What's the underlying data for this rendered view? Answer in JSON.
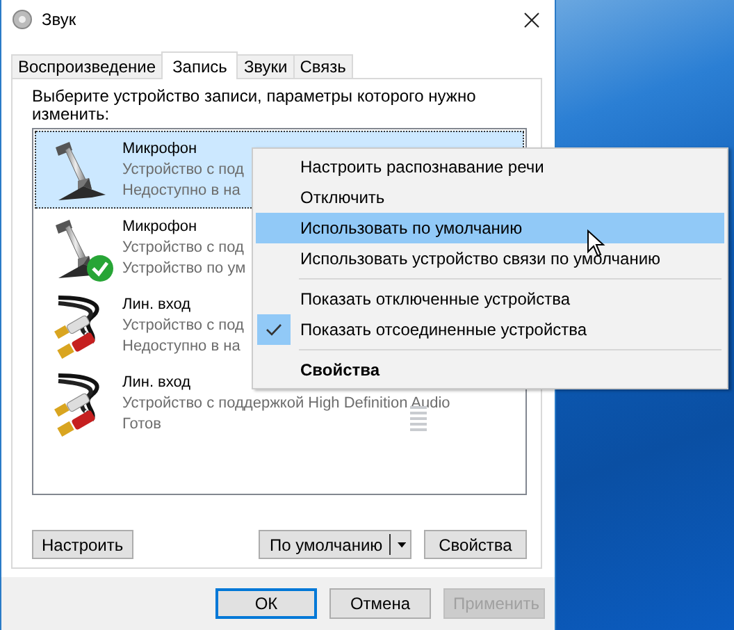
{
  "window": {
    "title": "Звук"
  },
  "tabs": [
    {
      "label": "Воспроизведение",
      "selected": false
    },
    {
      "label": "Запись",
      "selected": true
    },
    {
      "label": "Звуки",
      "selected": false
    },
    {
      "label": "Связь",
      "selected": false
    }
  ],
  "instruction": "Выберите устройство записи, параметры которого нужно изменить:",
  "devices": [
    {
      "kind": "microphone",
      "name": "Микрофон",
      "line_1": "Устройство с под",
      "line_2": "Недоступно в на",
      "selected": true,
      "default": false
    },
    {
      "kind": "microphone",
      "name": "Микрофон",
      "line_1": "Устройство с под",
      "line_2": "Устройство по ум",
      "selected": false,
      "default": true
    },
    {
      "kind": "line-in",
      "name": "Лин. вход",
      "line_1": "Устройство с под",
      "line_2": "Недоступно в на",
      "selected": false,
      "default": false
    },
    {
      "kind": "line-in",
      "name": "Лин. вход",
      "line_1": "Устройство с поддержкой High Definition Audio",
      "line_2": "Готов",
      "selected": false,
      "default": false,
      "meter": {
        "level": 0
      }
    }
  ],
  "panel_buttons": {
    "configure": "Настроить",
    "set_default": "По умолчанию",
    "properties": "Свойства"
  },
  "dialog_buttons": [
    {
      "label": "ОК",
      "default": true,
      "disabled": false
    },
    {
      "label": "Отмена",
      "default": false,
      "disabled": false
    },
    {
      "label": "Применить",
      "default": false,
      "disabled": true
    }
  ],
  "context_menu": {
    "items": [
      {
        "kind": "item",
        "label": "Настроить распознавание речи",
        "selected": false,
        "checked": false,
        "bold": false
      },
      {
        "kind": "item",
        "label": "Отключить",
        "selected": false,
        "checked": false,
        "bold": false
      },
      {
        "kind": "item",
        "label": "Использовать по умолчанию",
        "selected": true,
        "checked": false,
        "bold": false
      },
      {
        "kind": "item",
        "label": "Использовать устройство связи по умолчанию",
        "selected": false,
        "checked": false,
        "bold": false
      },
      {
        "kind": "separator"
      },
      {
        "kind": "item",
        "label": "Показать отключенные устройства",
        "selected": false,
        "checked": false,
        "bold": false
      },
      {
        "kind": "item",
        "label": "Показать отсоединенные устройства",
        "selected": false,
        "checked": true,
        "bold": false
      },
      {
        "kind": "separator"
      },
      {
        "kind": "item",
        "label": "Свойства",
        "selected": false,
        "checked": false,
        "bold": true
      }
    ]
  }
}
